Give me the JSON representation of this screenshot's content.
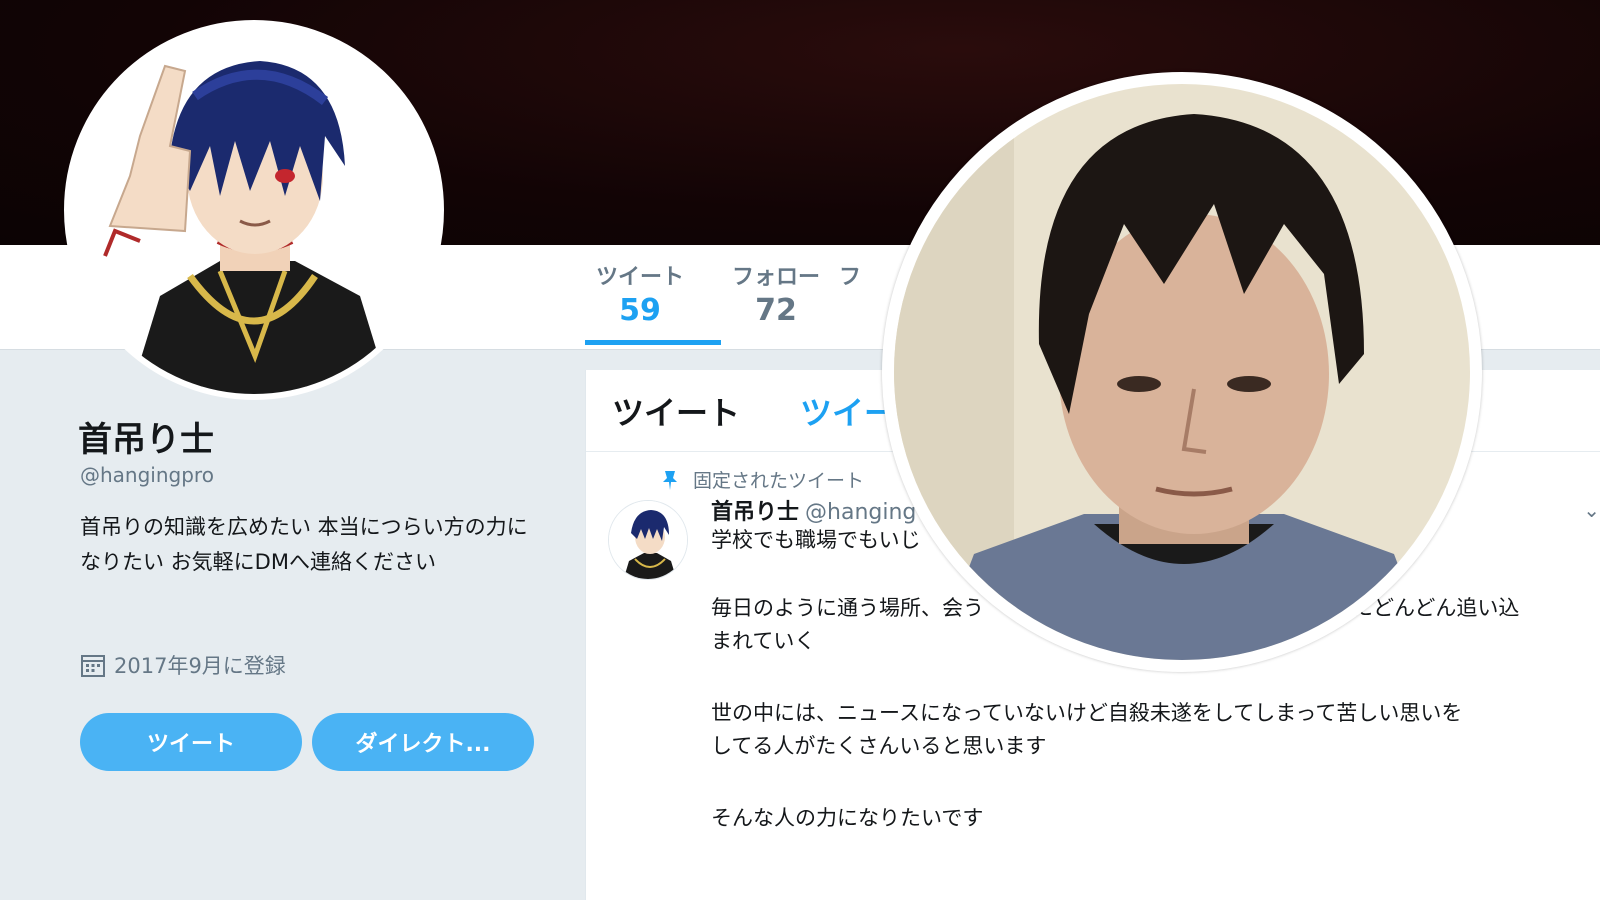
{
  "profile": {
    "name": "首吊り士",
    "handle": "@hangingpro",
    "bio": "首吊りの知識を広めたい 本当につらい方の力になりたい お気軽にDMへ連絡ください",
    "joined": "2017年9月に登録",
    "avatar_icon": "anime-character-avatar"
  },
  "nav": {
    "tweets_label": "ツイート",
    "tweets_count": "59",
    "following_label": "フォロー",
    "following_count": "72",
    "followers_label_partial": "フ"
  },
  "buttons": {
    "tweet": "ツイート",
    "direct": "ダイレクト..."
  },
  "timeline": {
    "tab_tweets": "ツイート",
    "tab_partial": "ツイー",
    "pinned_label": "固定されたツイート",
    "tweet": {
      "author_name": "首吊り士",
      "author_handle_partial": "@hanging",
      "lines": [
        "学校でも職場でもいじ",
        "毎日のように通う場所、会う",
        "まれていく",
        "世の中には、ニュースになっていないけど自殺未遂をしてしまって苦しい思いを",
        "してる人がたくさんいると思います",
        "そんな人の力になりたいです"
      ],
      "line_partial_right": "向にどんどん追い込"
    }
  },
  "overlay": {
    "photo_icon": "person-portrait-photo"
  },
  "colors": {
    "accent": "#1da1f2",
    "button": "#4ab3f4",
    "banner": "#120405",
    "sidebar": "#e6ecf0"
  }
}
